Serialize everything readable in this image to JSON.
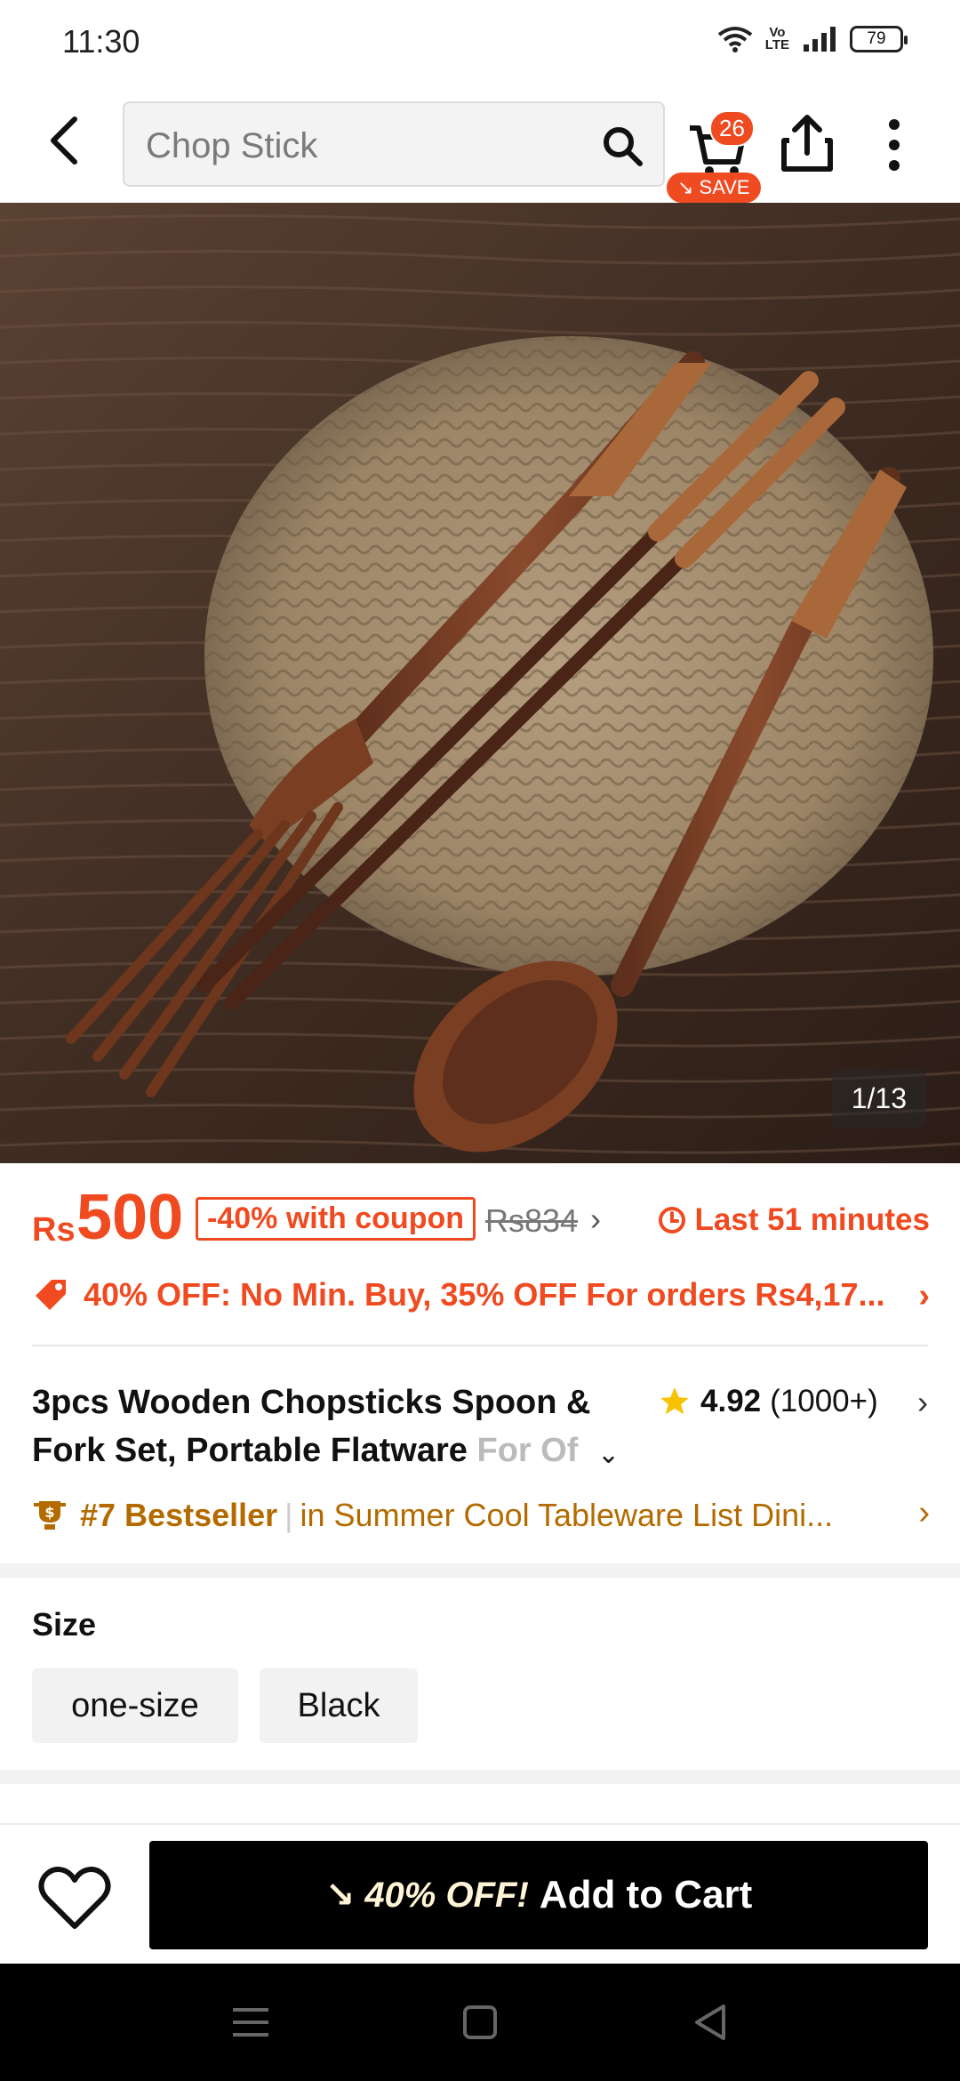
{
  "status_bar": {
    "time": "11:30",
    "battery": "79"
  },
  "search": {
    "query": "Chop Stick"
  },
  "cart": {
    "count": "26",
    "save_label": "SAVE"
  },
  "gallery": {
    "counter": "1/13"
  },
  "pricing": {
    "currency": "Rs",
    "price": "500",
    "coupon": "-40% with coupon",
    "original_price": "Rs834",
    "timer": "Last 51 minutes"
  },
  "promo": {
    "text": "40% OFF: No Min. Buy,  35% OFF For orders Rs4,17..."
  },
  "product": {
    "title_line1": "3pcs Wooden Chopsticks Spoon &",
    "title_line2": "Fork Set, Portable Flatware ",
    "title_fade": "For Of",
    "rating": "4.92",
    "review_count": "(1000+)"
  },
  "bestseller": {
    "rank": "#7 Bestseller",
    "list": "in Summer Cool Tableware List Dini..."
  },
  "size": {
    "label": "Size",
    "options": [
      "one-size",
      "Black"
    ]
  },
  "cta": {
    "discount": "40% OFF!",
    "label": "Add to Cart"
  },
  "colors": {
    "accent": "#f04a21",
    "bestseller": "#b36b00",
    "cta_bg": "#000000"
  }
}
